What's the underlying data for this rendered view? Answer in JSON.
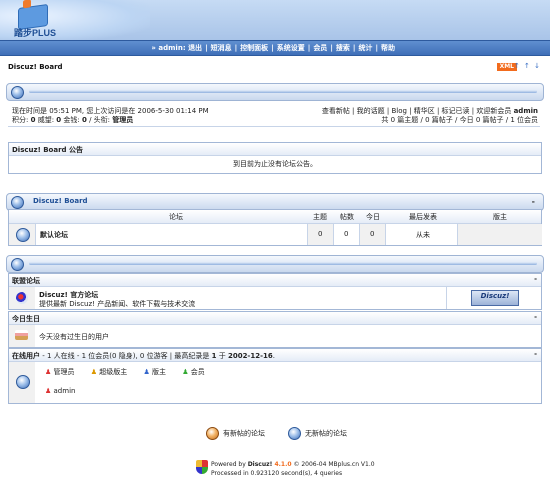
{
  "logo": {
    "text": "踏步PLUS"
  },
  "topnav": {
    "prefix": "» ",
    "user": "admin",
    "items": [
      "退出",
      "短消息",
      "控制面板",
      "系统设置",
      "会员",
      "搜索",
      "统计",
      "帮助"
    ]
  },
  "board": {
    "name": "Discuz! Board",
    "xml_badge": "XML",
    "arrows": "↑ ↑ ↓"
  },
  "status": {
    "line1": "现在时间是  05:51 PM, 您上次访问是在  2006-5-30 01:14 PM",
    "links": "查看新帖 | 我的话题 | Blog | 精华区 | 标记已读 | 欢迎新会员  ",
    "newest_member": "admin",
    "points_label": "积分: ",
    "points": "0",
    "prestige_label": " 威望: ",
    "prestige": "0",
    "money_label": " 金钱: ",
    "money": "0",
    "rank_label": " / 头衔: ",
    "rank": "管理员",
    "totals": "共  0 篇主题  / 0 篇帖子  / 今日  0 篇帖子  / 1 位会员"
  },
  "announce": {
    "title": "Discuz! Board 公告",
    "text": "到目前为止没有论坛公告。"
  },
  "forum_section": {
    "title": "Discuz! Board",
    "minimize": "-",
    "headers": [
      "论坛",
      "主题",
      "帖数",
      "今日",
      "最后发表",
      "版主"
    ],
    "rows": [
      {
        "name": "默认论坛",
        "topics": "0",
        "posts": "0",
        "today": "0",
        "last": "从未",
        "mods": ""
      }
    ]
  },
  "links": {
    "title": "联盟论坛",
    "minimize": "-",
    "name": "Discuz! 官方论坛",
    "desc": "提供最新 Discuz! 产品新闻、软件下载与技术交流",
    "banner": "Discuz!"
  },
  "birthday": {
    "title": "今日生日",
    "minimize": "-",
    "text": "今天没有过生日的用户"
  },
  "online": {
    "title": "在线用户",
    "stats_a": " - 1 人在线 - 1 位会员(0 隐身), 0 位游客 | 最高纪录是 ",
    "record": "1",
    "stats_b": " 于  ",
    "record_date": "2002-12-16",
    "stats_c": ".",
    "minimize": "-",
    "legend": [
      "管理员",
      "超级版主",
      "版主",
      "会员"
    ],
    "users": [
      "admin"
    ]
  },
  "legend_bottom": {
    "new": "有新帖的论坛",
    "nonew": "无新帖的论坛"
  },
  "footer": {
    "line1_a": "Powered by ",
    "brand": "Discuz!",
    "version": " 4.1.0",
    "line1_b": "  © 2006-04 MBplus.cn V1.0",
    "line2": "Processed in 0.923120 second(s), 4 queries"
  },
  "colors": {
    "nav": "#3f6fb8",
    "accent": "#f26b1d",
    "border": "#a3b7d6"
  }
}
